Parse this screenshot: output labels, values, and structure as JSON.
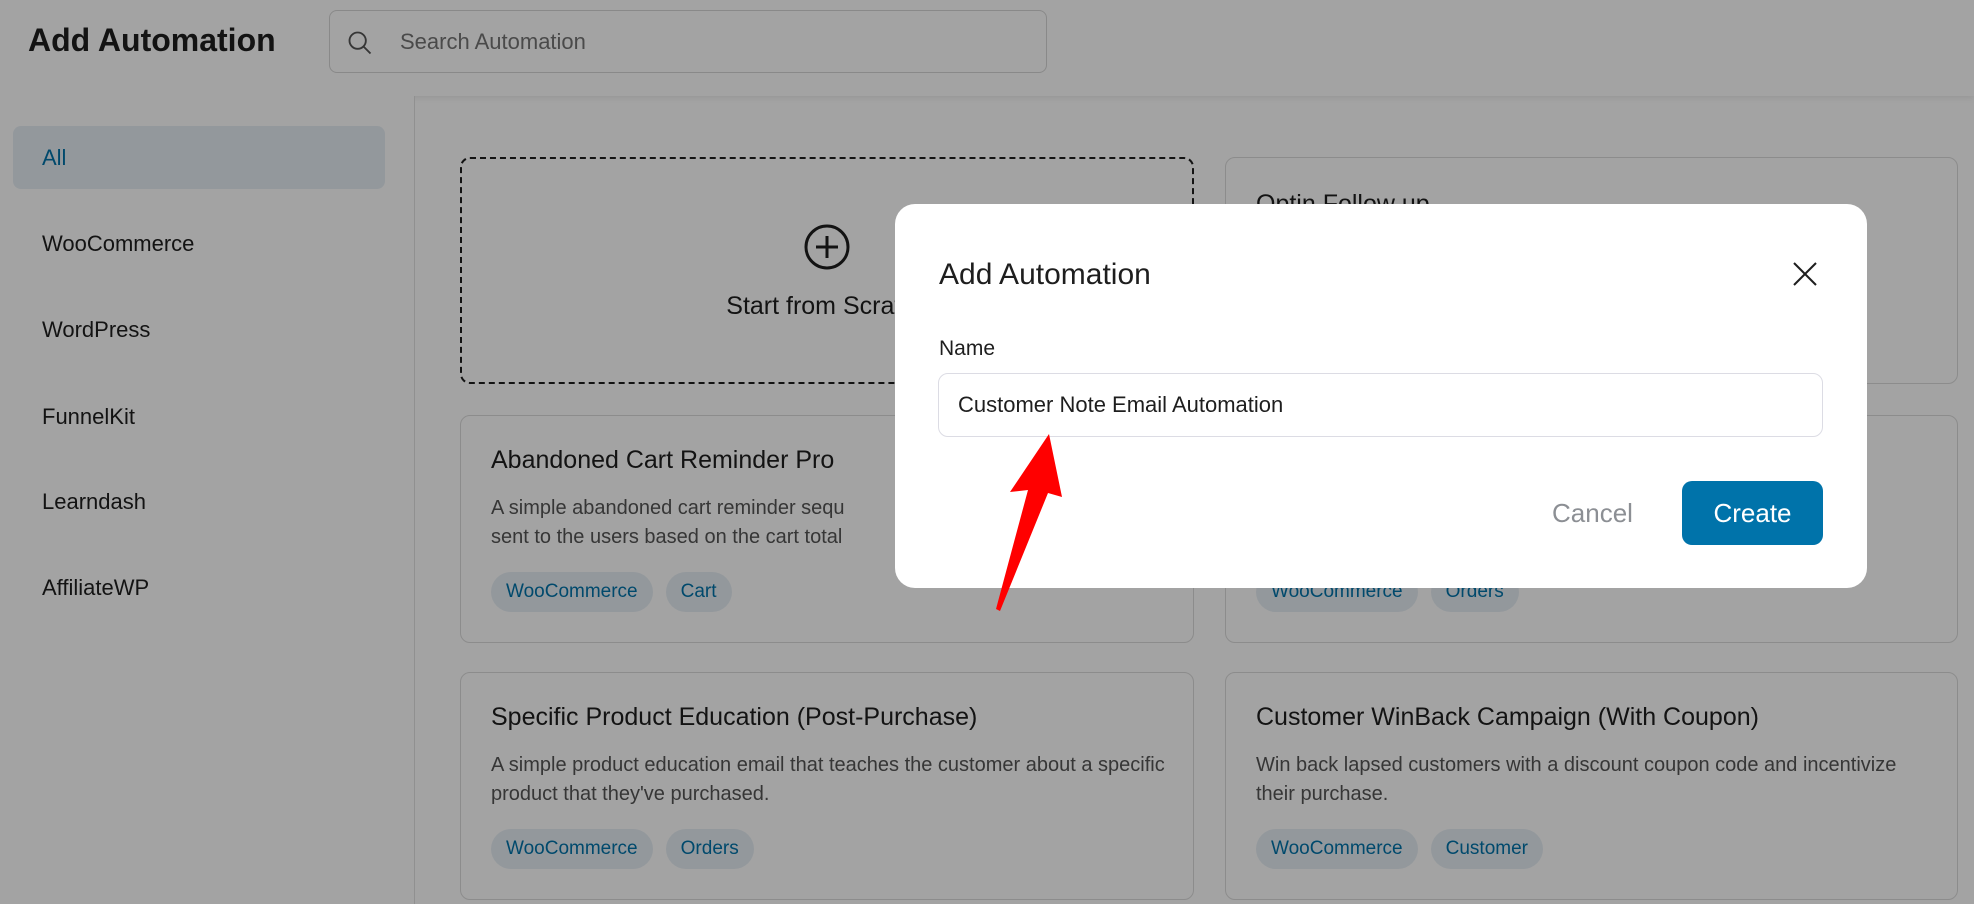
{
  "header": {
    "title": "Add Automation",
    "search_placeholder": "Search Automation",
    "search_icon": "search-icon"
  },
  "sidebar": {
    "items": [
      {
        "label": "All",
        "active": true
      },
      {
        "label": "WooCommerce"
      },
      {
        "label": "WordPress"
      },
      {
        "label": "FunnelKit"
      },
      {
        "label": "Learndash"
      },
      {
        "label": "AffiliateWP"
      }
    ]
  },
  "cards": {
    "scratch": {
      "label": "Start from Scratch",
      "icon": "plus-circle-icon"
    },
    "optin": {
      "title": "Optin Follow up"
    },
    "abandoned": {
      "title": "Abandoned Cart Reminder Pro",
      "desc1": "A simple abandoned cart reminder sequ",
      "desc2": "sent to the users based on the cart total",
      "tags": [
        "WooCommerce",
        "Cart"
      ]
    },
    "orders_card": {
      "tags": [
        "WooCommerce",
        "Orders"
      ]
    },
    "education": {
      "title": "Specific Product Education (Post-Purchase)",
      "desc": "A simple product education email that teaches the customer about a specific product that they've purchased.",
      "tags": [
        "WooCommerce",
        "Orders"
      ]
    },
    "winback": {
      "title": "Customer WinBack Campaign (With Coupon)",
      "desc": "Win back lapsed customers with a discount coupon code and incentivize their purchase.",
      "tags": [
        "WooCommerce",
        "Customer"
      ]
    }
  },
  "modal": {
    "title": "Add Automation",
    "name_label": "Name",
    "name_value": "Customer Note Email Automation",
    "cancel_label": "Cancel",
    "create_label": "Create",
    "close_icon": "close-icon"
  },
  "colors": {
    "accent": "#0073aa",
    "annotation_arrow": "#ff0000"
  }
}
